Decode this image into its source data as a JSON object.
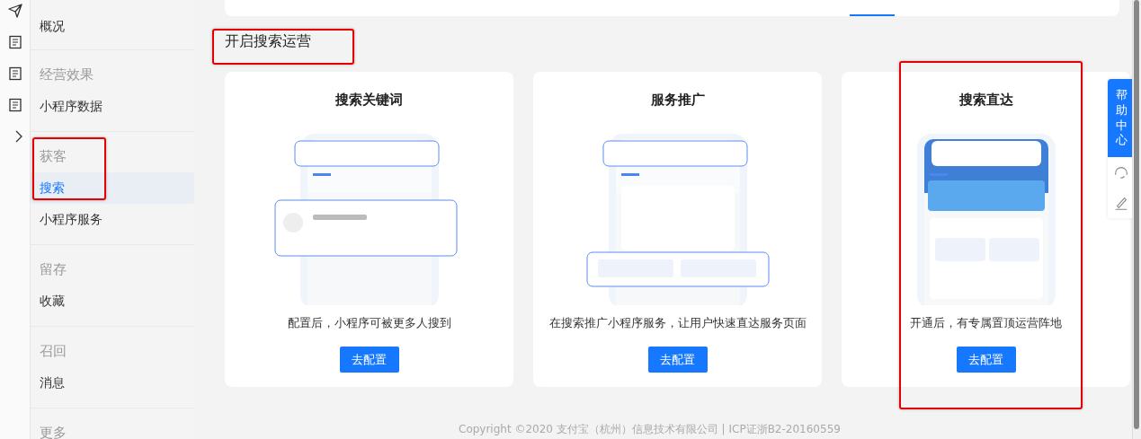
{
  "nav_groups": [
    {
      "highlighted": false,
      "items": [
        {
          "label": "概况",
          "selected": false
        }
      ]
    },
    {
      "title": "经营效果",
      "highlighted": false,
      "items": [
        {
          "label": "小程序数据",
          "selected": false
        }
      ]
    },
    {
      "title": "获客",
      "highlighted": true,
      "items": [
        {
          "label": "搜索",
          "selected": true
        },
        {
          "label": "小程序服务",
          "selected": false
        }
      ]
    },
    {
      "title": "留存",
      "highlighted": false,
      "items": [
        {
          "label": "收藏",
          "selected": false
        }
      ]
    },
    {
      "title": "召回",
      "highlighted": false,
      "items": [
        {
          "label": "消息",
          "selected": false
        }
      ]
    },
    {
      "title": "更多",
      "highlighted": false
    }
  ],
  "section": {
    "title": "开启搜索运营",
    "highlighted": true
  },
  "cards": [
    {
      "title": "搜索关键词",
      "description": "配置后，小程序可被更多人搜到",
      "button": "去配置",
      "highlighted": false
    },
    {
      "title": "服务推广",
      "description": "在搜索推广小程序服务，让用户快速直达服务页面",
      "button": "去配置",
      "highlighted": false
    },
    {
      "title": "搜索直达",
      "description": "开通后，有专属置顶运营阵地",
      "button": "去配置",
      "highlighted": true
    }
  ],
  "help": {
    "label": "帮助中心"
  },
  "footer": "Copyright ©2020 支付宝（杭州）信息技术有限公司 | ICP证浙B2-20160559"
}
